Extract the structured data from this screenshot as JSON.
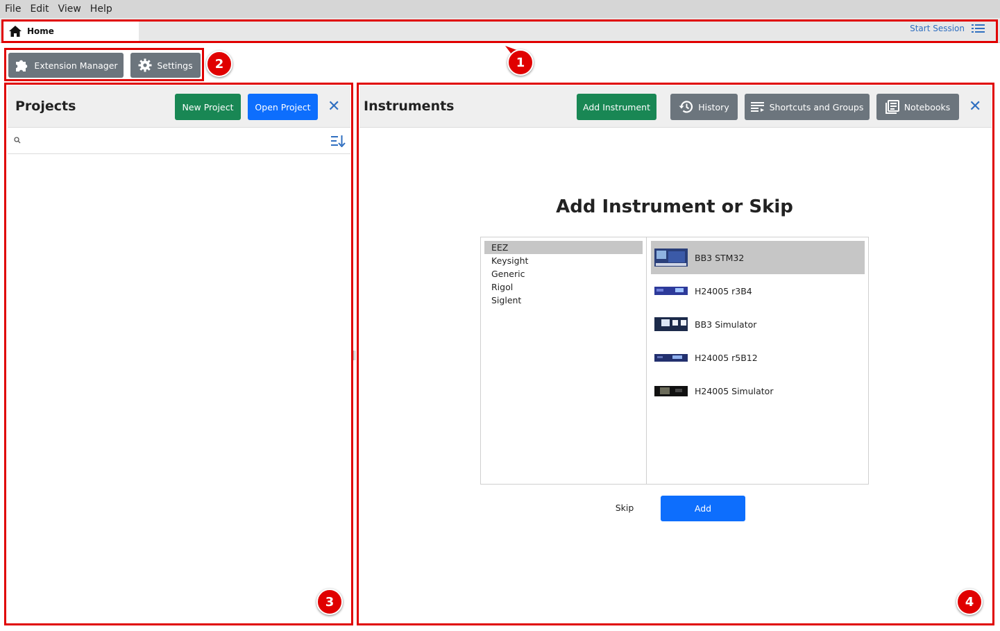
{
  "menu": [
    "File",
    "Edit",
    "View",
    "Help"
  ],
  "tab": {
    "home_label": "Home"
  },
  "session": {
    "start_label": "Start Session"
  },
  "toolbar": {
    "extension_manager": "Extension Manager",
    "settings": "Settings"
  },
  "projects": {
    "title": "Projects",
    "new_project": "New Project",
    "open_project": "Open Project",
    "close": "✕",
    "search_placeholder": ""
  },
  "instruments": {
    "title": "Instruments",
    "add_instrument": "Add Instrument",
    "history": "History",
    "shortcuts_groups": "Shortcuts and Groups",
    "notebooks": "Notebooks",
    "close": "✕"
  },
  "dialog": {
    "title": "Add Instrument or Skip",
    "vendors": [
      "EEZ",
      "Keysight",
      "Generic",
      "Rigol",
      "Siglent"
    ],
    "selected_vendor": "EEZ",
    "instruments": [
      "BB3 STM32",
      "H24005 r3B4",
      "BB3 Simulator",
      "H24005 r5B12",
      "H24005 Simulator"
    ],
    "selected_instrument": "BB3 STM32",
    "skip": "Skip",
    "add": "Add"
  },
  "annotations": [
    "1",
    "2",
    "3",
    "4"
  ],
  "colors": {
    "annotation_red": "#e00000",
    "primary_blue": "#0d6efd",
    "success_green": "#198754",
    "secondary_gray": "#6c757d",
    "link_blue": "#2f6fc0"
  }
}
